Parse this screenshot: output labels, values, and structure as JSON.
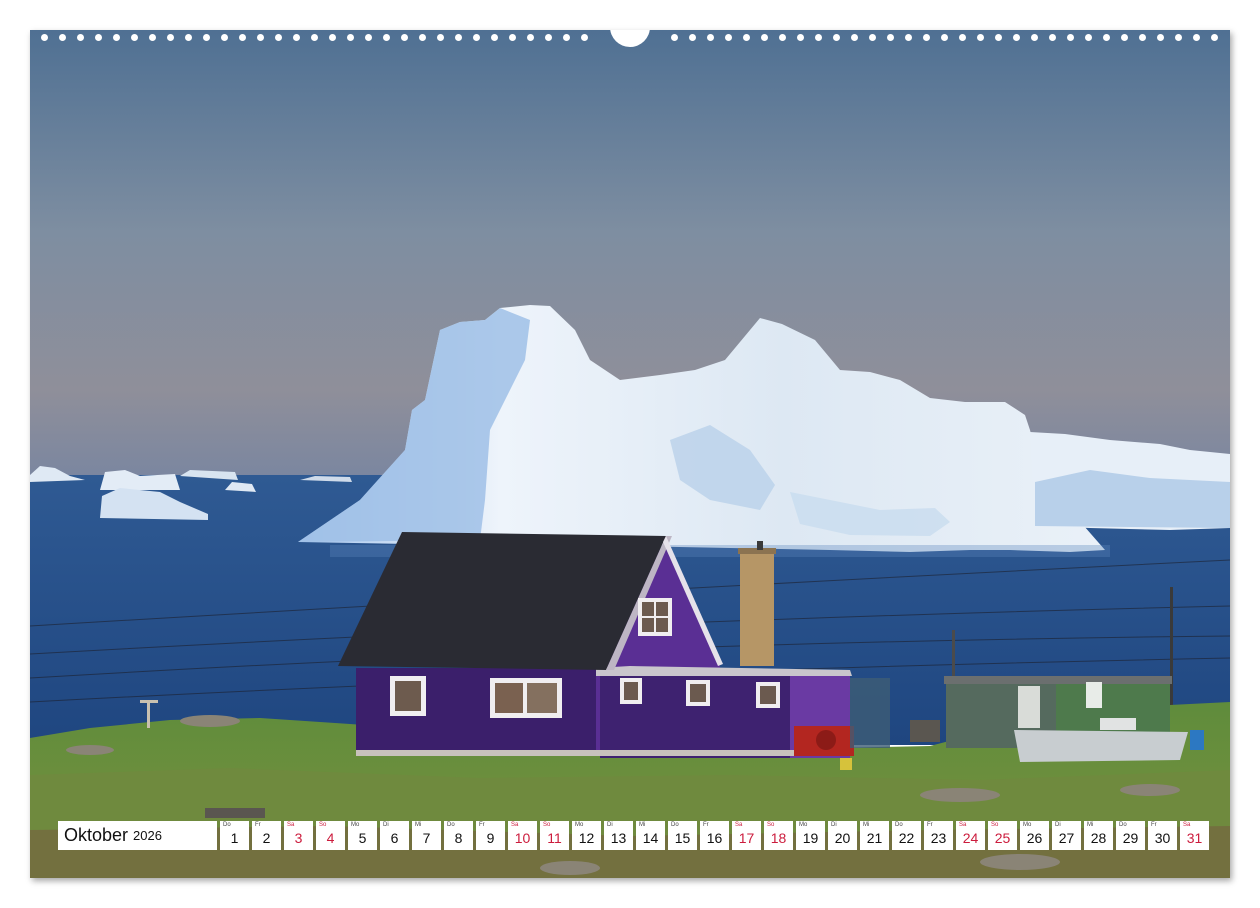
{
  "photo": {
    "subject": "Purple wooden house on a grassy shore with a large iceberg in the bay behind it",
    "icons": [
      "iceberg",
      "house",
      "chimney",
      "boat",
      "shed"
    ]
  },
  "binding_icon": "wire-binding-dots",
  "colors": {
    "weekday_text": "#111111",
    "weekend_text": "#cc1c3d",
    "cell_background": "#ffffff"
  },
  "calendar": {
    "month": "Oktober",
    "year": "2026",
    "days": [
      {
        "dow": "Do",
        "num": "1",
        "weekend": false
      },
      {
        "dow": "Fr",
        "num": "2",
        "weekend": false
      },
      {
        "dow": "Sa",
        "num": "3",
        "weekend": true
      },
      {
        "dow": "So",
        "num": "4",
        "weekend": true
      },
      {
        "dow": "Mo",
        "num": "5",
        "weekend": false
      },
      {
        "dow": "Di",
        "num": "6",
        "weekend": false
      },
      {
        "dow": "Mi",
        "num": "7",
        "weekend": false
      },
      {
        "dow": "Do",
        "num": "8",
        "weekend": false
      },
      {
        "dow": "Fr",
        "num": "9",
        "weekend": false
      },
      {
        "dow": "Sa",
        "num": "10",
        "weekend": true
      },
      {
        "dow": "So",
        "num": "11",
        "weekend": true
      },
      {
        "dow": "Mo",
        "num": "12",
        "weekend": false
      },
      {
        "dow": "Di",
        "num": "13",
        "weekend": false
      },
      {
        "dow": "Mi",
        "num": "14",
        "weekend": false
      },
      {
        "dow": "Do",
        "num": "15",
        "weekend": false
      },
      {
        "dow": "Fr",
        "num": "16",
        "weekend": false
      },
      {
        "dow": "Sa",
        "num": "17",
        "weekend": true
      },
      {
        "dow": "So",
        "num": "18",
        "weekend": true
      },
      {
        "dow": "Mo",
        "num": "19",
        "weekend": false
      },
      {
        "dow": "Di",
        "num": "20",
        "weekend": false
      },
      {
        "dow": "Mi",
        "num": "21",
        "weekend": false
      },
      {
        "dow": "Do",
        "num": "22",
        "weekend": false
      },
      {
        "dow": "Fr",
        "num": "23",
        "weekend": false
      },
      {
        "dow": "Sa",
        "num": "24",
        "weekend": true
      },
      {
        "dow": "So",
        "num": "25",
        "weekend": true
      },
      {
        "dow": "Mo",
        "num": "26",
        "weekend": false
      },
      {
        "dow": "Di",
        "num": "27",
        "weekend": false
      },
      {
        "dow": "Mi",
        "num": "28",
        "weekend": false
      },
      {
        "dow": "Do",
        "num": "29",
        "weekend": false
      },
      {
        "dow": "Fr",
        "num": "30",
        "weekend": false
      },
      {
        "dow": "Sa",
        "num": "31",
        "weekend": true
      }
    ]
  }
}
